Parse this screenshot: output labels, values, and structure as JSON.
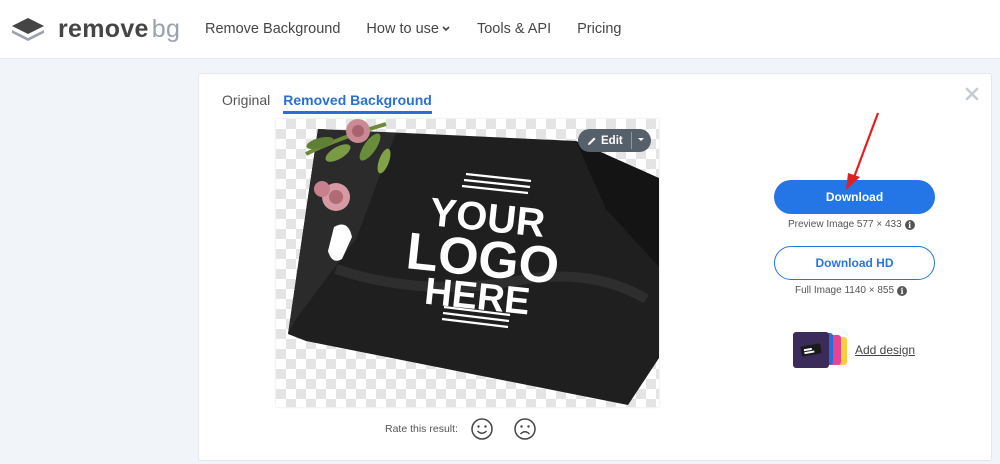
{
  "brand": {
    "name_main": "remove",
    "name_suffix": "bg"
  },
  "nav": {
    "items": [
      {
        "label": "Remove Background"
      },
      {
        "label": "How to use",
        "has_dropdown": true
      },
      {
        "label": "Tools & API"
      },
      {
        "label": "Pricing"
      }
    ]
  },
  "tabs": [
    {
      "label": "Original",
      "active": false
    },
    {
      "label": "Removed Background",
      "active": true
    }
  ],
  "preview": {
    "edit_label": "Edit",
    "image_text": [
      "YOUR",
      "LOGO",
      "HERE"
    ]
  },
  "rating": {
    "label": "Rate this result:"
  },
  "download": {
    "label": "Download",
    "info": "Preview Image 577 × 433"
  },
  "download_hd": {
    "label": "Download HD",
    "info": "Full Image 1140 × 855"
  },
  "add_design": {
    "label": "Add design"
  },
  "colors": {
    "accent": "#2476e6",
    "arrow": "#e41e1e",
    "page_bg": "#f1f5f9"
  }
}
